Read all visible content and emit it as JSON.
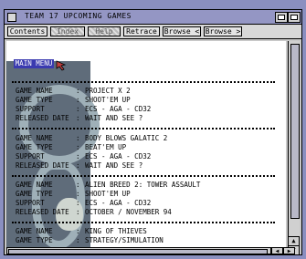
{
  "window": {
    "title": "TEAM 17 UPCOMING GAMES"
  },
  "toolbar": {
    "buttons": [
      {
        "label": "Contents",
        "enabled": true
      },
      {
        "label": "Index",
        "enabled": false
      },
      {
        "label": "Help",
        "enabled": false
      },
      {
        "label": "Retrace",
        "enabled": true
      },
      {
        "label": "Browse <",
        "enabled": true
      },
      {
        "label": "Browse >",
        "enabled": true
      }
    ]
  },
  "content": {
    "main_menu_link": "MAIN MENU",
    "entries": [
      {
        "game_name_label": "GAME NAME",
        "game_name": "PROJECT X 2",
        "game_type_label": "GAME TYPE",
        "game_type": "SHOOT'EM UP",
        "support_label": "SUPPORT",
        "support": "ECS - AGA - CD32",
        "released_label": "RELEASED DATE",
        "released": "WAIT AND SEE ?"
      },
      {
        "game_name_label": "GAME NAME",
        "game_name": "BODY BLOWS GALATIC 2",
        "game_type_label": "GAME TYPE",
        "game_type": "BEAT'EM UP",
        "support_label": "SUPPORT",
        "support": "ECS - AGA - CD32",
        "released_label": "RELEASED DATE",
        "released": "WAIT AND SEE ?"
      },
      {
        "game_name_label": "GAME NAME",
        "game_name": "ALIEN BREED 2: TOWER ASSAULT",
        "game_type_label": "GAME TYPE",
        "game_type": "SHOOT'EM UP",
        "support_label": "SUPPORT",
        "support": "ECS - AGA - CD32",
        "released_label": "RELEASED DATE",
        "released": "OCTOBER / NOVEMBER 94"
      },
      {
        "game_name_label": "GAME NAME",
        "game_name": "KING OF THIEVES",
        "game_type_label": "GAME TYPE",
        "game_type": "STRATEGY/SIMULATION"
      }
    ],
    "separator": ":"
  },
  "colors": {
    "desktop": "#8a8fc0",
    "titlebar": "#9496c4",
    "link_highlight": "#3a3ab0"
  }
}
